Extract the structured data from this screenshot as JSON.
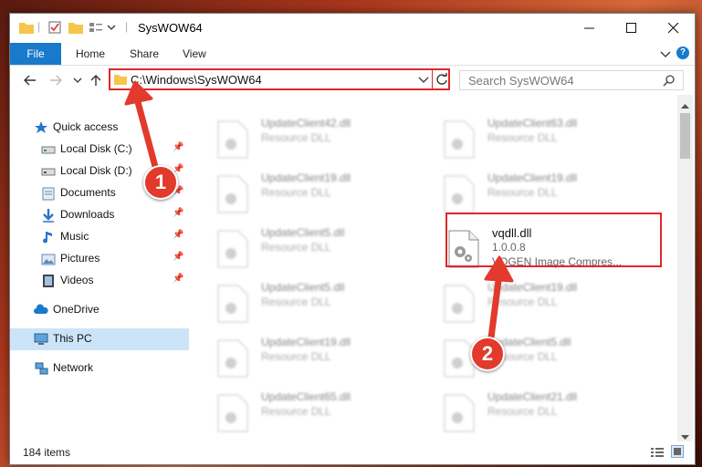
{
  "window": {
    "title": "SysWOW64"
  },
  "ribbon": {
    "tabs": [
      "File",
      "Home",
      "Share",
      "View"
    ]
  },
  "address": {
    "path": "C:\\Windows\\SysWOW64",
    "search_placeholder": "Search SysWOW64"
  },
  "nav": {
    "items": [
      {
        "label": "Quick access",
        "icon": "star-icon"
      },
      {
        "label": "Local Disk (C:)",
        "icon": "drive-icon",
        "pinned": true
      },
      {
        "label": "Local Disk (D:)",
        "icon": "drive-icon",
        "pinned": true
      },
      {
        "label": "Documents",
        "icon": "documents-icon",
        "pinned": true
      },
      {
        "label": "Downloads",
        "icon": "downloads-icon",
        "pinned": true
      },
      {
        "label": "Music",
        "icon": "music-icon",
        "pinned": true
      },
      {
        "label": "Pictures",
        "icon": "pictures-icon",
        "pinned": true
      },
      {
        "label": "Videos",
        "icon": "videos-icon",
        "pinned": true
      },
      {
        "label": "OneDrive",
        "icon": "cloud-icon"
      },
      {
        "label": "This PC",
        "icon": "computer-icon",
        "selected": true
      },
      {
        "label": "Network",
        "icon": "network-icon"
      }
    ]
  },
  "files": [
    {
      "name": "UpdateClient42.dll",
      "desc": "Resource DLL"
    },
    {
      "name": "UpdateClient63.dll",
      "desc": "Resource DLL"
    },
    {
      "name": "UpdateClient19.dll",
      "desc": "Resource DLL"
    },
    {
      "name": "UpdateClient19.dll",
      "desc": "Resource DLL"
    },
    {
      "name": "UpdateClient5.dll",
      "desc": "Resource DLL"
    },
    {
      "name": "vqdll.dll",
      "desc": "1.0.0.8",
      "desc2": "VQGEN Image Compres...",
      "highlighted": true
    },
    {
      "name": "UpdateClient5.dll",
      "desc": "Resource DLL"
    },
    {
      "name": "UpdateClient19.dll",
      "desc": "Resource DLL"
    },
    {
      "name": "UpdateClient19.dll",
      "desc": "Resource DLL"
    },
    {
      "name": "UpdateClient5.dll",
      "desc": "Resource DLL"
    },
    {
      "name": "UpdateClient65.dll",
      "desc": "Resource DLL"
    },
    {
      "name": "UpdateClient21.dll",
      "desc": "Resource DLL"
    }
  ],
  "status": {
    "items_count": "184 items"
  },
  "callouts": [
    "1",
    "2"
  ],
  "colors": {
    "accent": "#1979ca",
    "highlight": "#e0262a",
    "callout": "#e23a2c"
  }
}
